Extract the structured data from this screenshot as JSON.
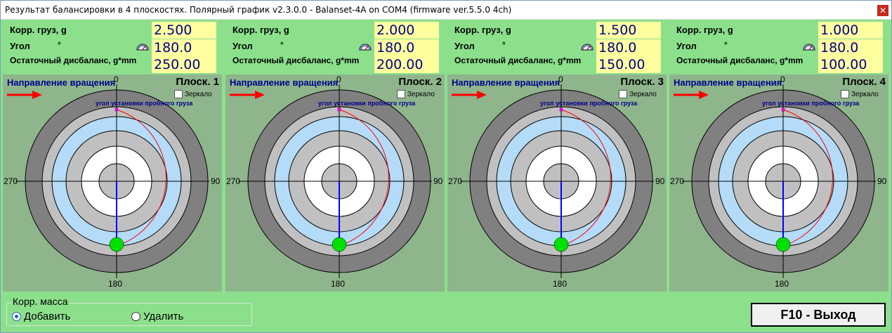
{
  "window": {
    "title": "Результат балансировки в 4 плоскостях. Полярный график v2.3.0.0 - Balanset-4A on COM4 (firmware ver.5.5.0 4ch)",
    "close_glyph": "✕"
  },
  "labels": {
    "corr_weight": "Корр. груз, g",
    "angle": "Угол",
    "degree_sign": "°",
    "residual": "Остаточный дисбаланс, g*mm",
    "rotation_direction": "Направление вращения",
    "mirror": "Зеркало",
    "trial_weight_angle": "угол установки пробного   груза",
    "axis_top": "0",
    "axis_right": "90",
    "axis_bottom": "180",
    "axis_left": "270"
  },
  "planes": [
    {
      "title": "Плоск. 1",
      "corr_weight": "2.500",
      "angle": "180.0",
      "residual": "250.00",
      "mirror_checked": false
    },
    {
      "title": "Плоск. 2",
      "corr_weight": "2.000",
      "angle": "180.0",
      "residual": "200.00",
      "mirror_checked": false
    },
    {
      "title": "Плоск. 3",
      "corr_weight": "1.500",
      "angle": "180.0",
      "residual": "150.00",
      "mirror_checked": false
    },
    {
      "title": "Плоск. 4",
      "corr_weight": "1.000",
      "angle": "180.0",
      "residual": "100.00",
      "mirror_checked": false
    }
  ],
  "corr_mass": {
    "title": "Корр. масса",
    "add_label": "Добавить",
    "remove_label": "Удалить",
    "selected": "add"
  },
  "exit_button": "F10 - Выход",
  "colors": {
    "background": "#8ce08c",
    "plot_background": "#8fb58c",
    "value_box": "#ffffa0",
    "value_text": "#00008b",
    "ring_dark": "#808080",
    "ring_gray": "#c0c0c0",
    "ring_blue": "#b4dcf8",
    "ring_white": "#ffffff",
    "vector": "#0000ff",
    "arc": "#ff0000",
    "marker": "#00e000",
    "arrow": "#ff0000"
  },
  "icons": {
    "gauge": "gauge-icon",
    "arrow": "rotation-arrow-icon"
  }
}
